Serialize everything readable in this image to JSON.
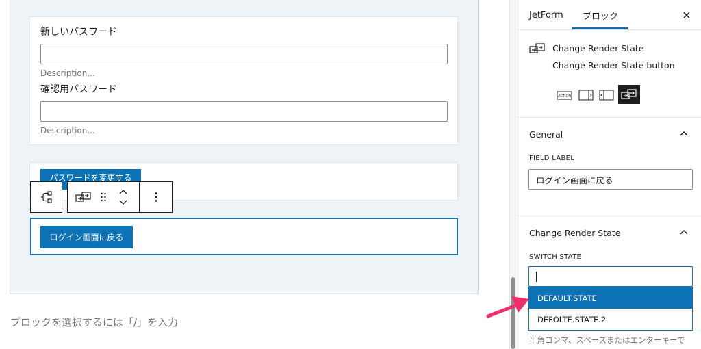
{
  "form": {
    "new_password_label": "新しいパスワード",
    "new_password_value": "",
    "new_password_description": "Description...",
    "confirm_password_label": "確認用パスワード",
    "confirm_password_value": "",
    "confirm_password_description": "Description...",
    "change_password_button": "パスワードを変更する",
    "back_to_login_button": "ログイン画面に戻る"
  },
  "toolbar": {
    "parent_icon": "parent-block-icon",
    "block_type_icon": "change-render-state-icon",
    "drag_icon": "drag-handle-icon",
    "move_icon": "move-up-down-icon",
    "options_icon": "more-options-icon"
  },
  "appender": {
    "placeholder": "ブロックを選択するには「/」を入力"
  },
  "sidebar": {
    "tabs": [
      {
        "label": "JetForm",
        "active": false
      },
      {
        "label": "ブロック",
        "active": true
      }
    ],
    "block": {
      "title": "Change Render State",
      "description": "Change Render State button"
    },
    "style_options": [
      "ACTION",
      "arrow-right",
      "arrow-left",
      "render-state"
    ],
    "general": {
      "title": "General",
      "field_label_label": "FIELD LABEL",
      "field_label_value": "ログイン画面に戻る"
    },
    "render_state": {
      "title": "Change Render State",
      "switch_state_label": "SWITCH STATE",
      "switch_state_value": "",
      "options": [
        "DEFAULT.STATE",
        "DEFOLTE.STATE.2"
      ],
      "selected_option": "DEFAULT.STATE",
      "help_text": "半角コンマ、スペースまたはエンターキーで"
    }
  },
  "colors": {
    "accent": "#0a72b5",
    "focus_border": "#1a6fa8",
    "annotation_arrow": "#f0306c"
  }
}
